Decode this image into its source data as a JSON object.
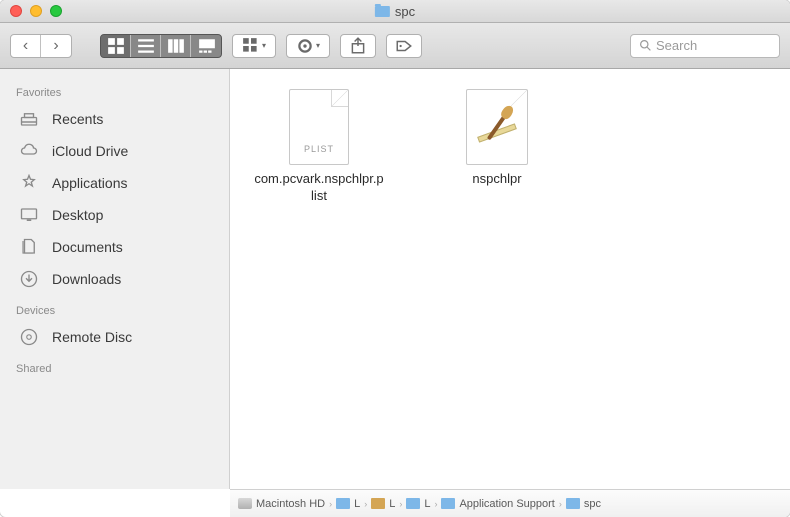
{
  "window": {
    "title": "spc"
  },
  "toolbar": {
    "search_placeholder": "Search"
  },
  "sidebar": {
    "sections": [
      {
        "header": "Favorites",
        "items": [
          {
            "label": "Recents",
            "icon": "recents-icon"
          },
          {
            "label": "iCloud Drive",
            "icon": "cloud-icon"
          },
          {
            "label": "Applications",
            "icon": "applications-icon"
          },
          {
            "label": "Desktop",
            "icon": "desktop-icon"
          },
          {
            "label": "Documents",
            "icon": "documents-icon"
          },
          {
            "label": "Downloads",
            "icon": "downloads-icon"
          }
        ]
      },
      {
        "header": "Devices",
        "items": [
          {
            "label": "Remote Disc",
            "icon": "disc-icon"
          }
        ]
      },
      {
        "header": "Shared",
        "items": []
      }
    ]
  },
  "files": [
    {
      "name": "com.pcvark.nspchlpr.plist",
      "kind": "plist"
    },
    {
      "name": "nspchlpr",
      "kind": "app"
    }
  ],
  "pathbar": [
    {
      "label": "Macintosh HD",
      "icon": "hd"
    },
    {
      "label": "L",
      "icon": "fld"
    },
    {
      "label": "L",
      "icon": "home"
    },
    {
      "label": "L",
      "icon": "fld"
    },
    {
      "label": "Application Support",
      "icon": "fld"
    },
    {
      "label": "spc",
      "icon": "fld"
    }
  ]
}
